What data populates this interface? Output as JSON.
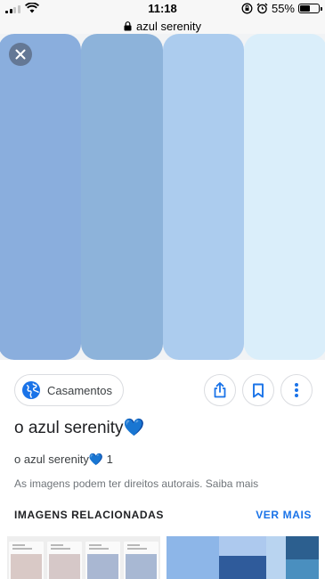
{
  "status_bar": {
    "time": "11:18",
    "battery_percent": "55%",
    "battery_level": 0.55
  },
  "url_bar": {
    "url": "azul serenity"
  },
  "image": {
    "swatch_colors": [
      "#8aaedd",
      "#8db3da",
      "#acccee",
      "#daeefa"
    ],
    "background": "#f1f3f5"
  },
  "actions": {
    "source_label": "Casamentos",
    "share_icon": "share-icon",
    "save_icon": "bookmark-icon",
    "more_icon": "more-vert-icon"
  },
  "result": {
    "title": "o azul serenity💙",
    "subtitle": "o azul serenity💙 1",
    "copyright": "As imagens podem ter direitos autorais. Saiba mais"
  },
  "related": {
    "header": "IMAGENS RELACIONADAS",
    "see_more": "VER MAIS"
  },
  "colors": {
    "accent": "#1a73e8",
    "icon_blue": "#1a73e8"
  }
}
